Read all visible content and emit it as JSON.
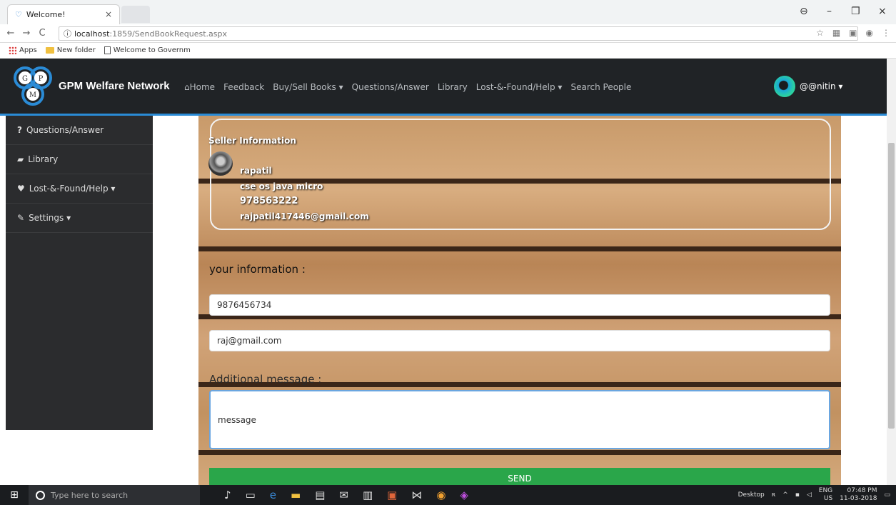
{
  "browser": {
    "tab_title": "Welcome!",
    "tab_close": "×",
    "url_host": "localhost",
    "url_path": ":1859/SendBookRequest.aspx",
    "bookmarks": [
      "Apps",
      "New folder",
      "Welcome to Governm"
    ],
    "window_controls": [
      "–",
      "❐",
      "×"
    ]
  },
  "navbar": {
    "brand": "GPM Welfare Network",
    "links": [
      "Home",
      "Feedback",
      "Buy/Sell Books ▾",
      "Questions/Answer",
      "Library",
      "Lost-&-Found/Help ▾",
      "Search People"
    ],
    "user": "@@nitin ▾"
  },
  "sidebar": {
    "items": [
      "Questions/Answer",
      "Library",
      "Lost-&-Found/Help ▾",
      "Settings ▾"
    ]
  },
  "seller": {
    "title": "Seller Information",
    "name": "rapatil",
    "subjects": "cse os java micro",
    "phone": "978563222",
    "email": "rajpatil417446@gmail.com"
  },
  "form": {
    "your_info_label": "your information :",
    "phone_value": "9876456734",
    "email_value": "raj@gmail.com",
    "additional_label": "Additional message :",
    "message_value": "message",
    "send_label": "SEND"
  },
  "taskbar": {
    "search_placeholder": "Type here to search",
    "desktop_label": "Desktop",
    "lang": "ENG",
    "region": "US",
    "time": "07:48 PM",
    "date": "11-03-2018"
  }
}
